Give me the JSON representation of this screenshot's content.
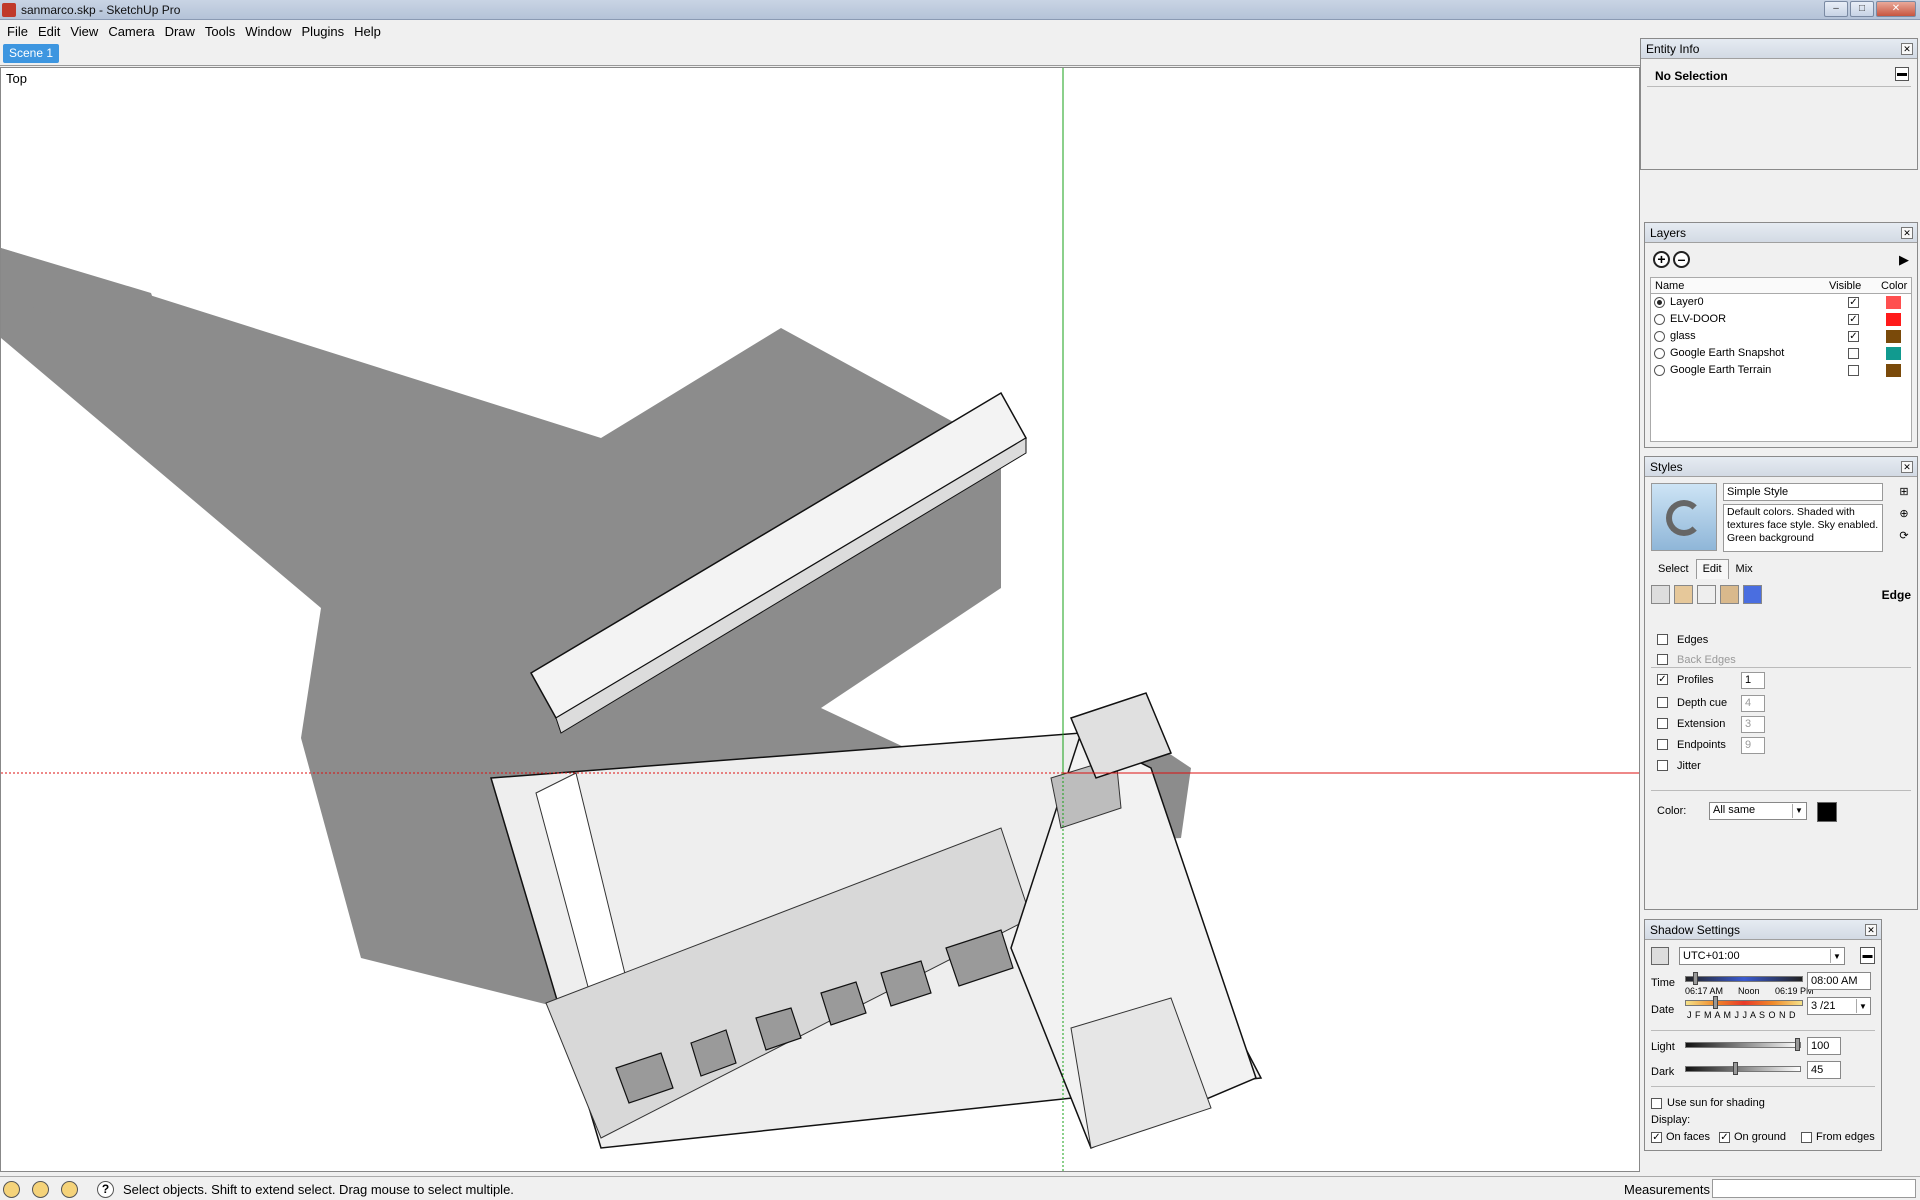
{
  "window": {
    "title": "sanmarco.skp - SketchUp Pro",
    "controls": {
      "minimize": "–",
      "maximize": "□",
      "close": "✕"
    }
  },
  "menu": [
    "File",
    "Edit",
    "View",
    "Camera",
    "Draw",
    "Tools",
    "Window",
    "Plugins",
    "Help"
  ],
  "scenes": {
    "tabs": [
      "Scene 1"
    ]
  },
  "viewport": {
    "view_label": "Top"
  },
  "entity_info": {
    "title": "Entity Info",
    "selection": "No Selection"
  },
  "layers": {
    "title": "Layers",
    "columns": {
      "name": "Name",
      "visible": "Visible",
      "color": "Color"
    },
    "rows": [
      {
        "name": "Layer0",
        "active": true,
        "visible": true,
        "color": "#ff4f4f"
      },
      {
        "name": "ELV-DOOR",
        "active": false,
        "visible": true,
        "color": "#ff1a1a"
      },
      {
        "name": "glass",
        "active": false,
        "visible": true,
        "color": "#7a4a0a"
      },
      {
        "name": "Google Earth Snapshot",
        "active": false,
        "visible": false,
        "color": "#119a8f"
      },
      {
        "name": "Google Earth Terrain",
        "active": false,
        "visible": false,
        "color": "#7a4a0a"
      }
    ]
  },
  "styles": {
    "title": "Styles",
    "style_name": "Simple Style",
    "description": "Default colors.  Shaded with textures face style.  Sky enabled.  Green background",
    "tabs": [
      "Select",
      "Edit",
      "Mix"
    ],
    "active_tab": "Edit",
    "section": "Edge",
    "options": [
      {
        "label": "Edges",
        "checked": false,
        "enabled": true,
        "value": ""
      },
      {
        "label": "Back Edges",
        "checked": false,
        "enabled": false,
        "value": ""
      },
      {
        "label": "Profiles",
        "checked": true,
        "enabled": true,
        "value": "1"
      },
      {
        "label": "Depth cue",
        "checked": false,
        "enabled": true,
        "value": "4"
      },
      {
        "label": "Extension",
        "checked": false,
        "enabled": true,
        "value": "3"
      },
      {
        "label": "Endpoints",
        "checked": false,
        "enabled": true,
        "value": "9"
      },
      {
        "label": "Jitter",
        "checked": false,
        "enabled": true,
        "value": ""
      }
    ],
    "color_label": "Color:",
    "color_value": "All same",
    "edge_color": "#000000"
  },
  "shadows": {
    "title": "Shadow Settings",
    "timezone": "UTC+01:00",
    "time_label": "Time",
    "time_start": "06:17 AM",
    "time_noon": "Noon",
    "time_end": "06:19 PM",
    "time_value": "08:00 AM",
    "date_label": "Date",
    "months": "J F M A M J J A S O N D",
    "date_value": "3 /21",
    "light_label": "Light",
    "light_value": "100",
    "dark_label": "Dark",
    "dark_value": "45",
    "use_sun": "Use sun for shading",
    "use_sun_checked": false,
    "display_label": "Display:",
    "on_faces": "On faces",
    "on_faces_checked": true,
    "on_ground": "On ground",
    "on_ground_checked": true,
    "from_edges": "From edges",
    "from_edges_checked": false
  },
  "status": {
    "hint": "Select objects. Shift to extend select. Drag mouse to select multiple.",
    "measurements_label": "Measurements",
    "measurements_value": ""
  }
}
